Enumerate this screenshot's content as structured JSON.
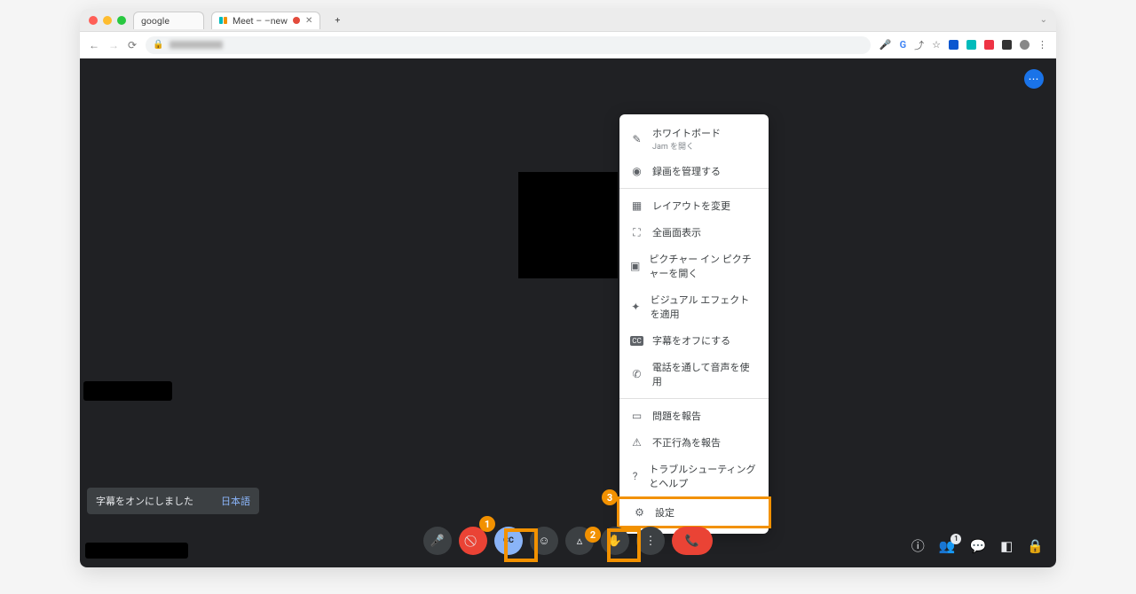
{
  "tabs": [
    {
      "label": "google"
    },
    {
      "label": "Meet – –new",
      "has_record": true,
      "has_close": true
    }
  ],
  "toast": {
    "text": "字幕をオンにしました",
    "lang": "日本語"
  },
  "menu": {
    "whiteboard": {
      "label": "ホワイトボード",
      "sub": "Jam を開く"
    },
    "recording": "録画を管理する",
    "layout": "レイアウトを変更",
    "fullscreen": "全画面表示",
    "pip": "ピクチャー イン ピクチャーを開く",
    "effects": "ビジュアル エフェクトを適用",
    "captions": "字幕をオフにする",
    "phone": "電話を通して音声を使用",
    "feedback": "問題を報告",
    "abuse": "不正行為を報告",
    "help": "トラブルシューティングとヘルプ",
    "settings": "設定"
  },
  "annotations": {
    "a1": "1",
    "a2": "2",
    "a3": "3"
  },
  "participants_count": "1",
  "colors": {
    "blue": "#0a57d0",
    "cyan": "#0bb",
    "red": "#e34",
    "orange": "#f90",
    "gray": "#999"
  }
}
